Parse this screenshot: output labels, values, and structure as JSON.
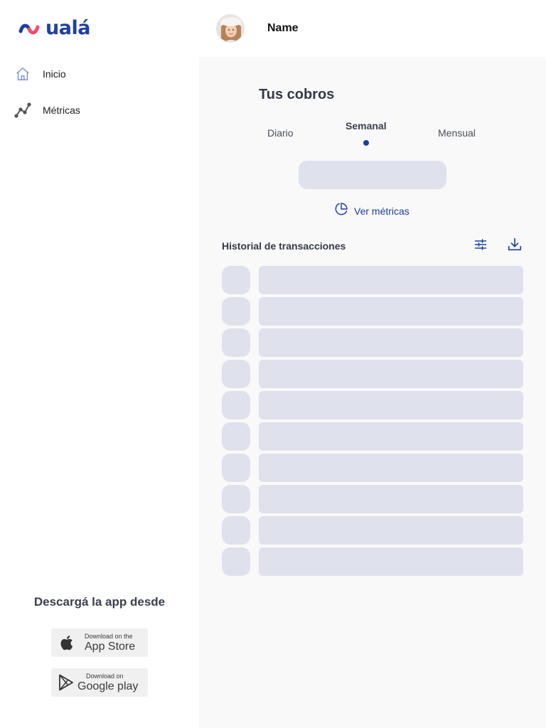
{
  "brand": {
    "logo_text": "ualá",
    "colors": {
      "primary": "#1e3fa3",
      "accent": "#f24d6b",
      "skeleton": "#dfe2ec"
    }
  },
  "sidebar": {
    "items": [
      {
        "label": "Inicio",
        "icon": "home-icon"
      },
      {
        "label": "Métricas",
        "icon": "metrics-icon"
      }
    ],
    "download": {
      "title": "Descargá la app desde",
      "app_store": {
        "small": "Download on the",
        "big": "App Store",
        "icon": "apple-icon"
      },
      "google_play": {
        "small": "Download on",
        "big": "Google play",
        "icon": "play-icon"
      }
    }
  },
  "header": {
    "user_name": "Name",
    "avatar_icon": "avatar"
  },
  "main": {
    "title": "Tus cobros",
    "tabs": [
      {
        "label": "Diario",
        "active": false
      },
      {
        "label": "Semanal",
        "active": true
      },
      {
        "label": "Mensual",
        "active": false
      }
    ],
    "metrics_link": {
      "label": "Ver métricas",
      "icon": "pie-chart-icon"
    },
    "history": {
      "title": "Historial de transacciones",
      "filter_icon": "filter-sliders-icon",
      "download_icon": "download-icon",
      "placeholder_rows": 10
    }
  }
}
